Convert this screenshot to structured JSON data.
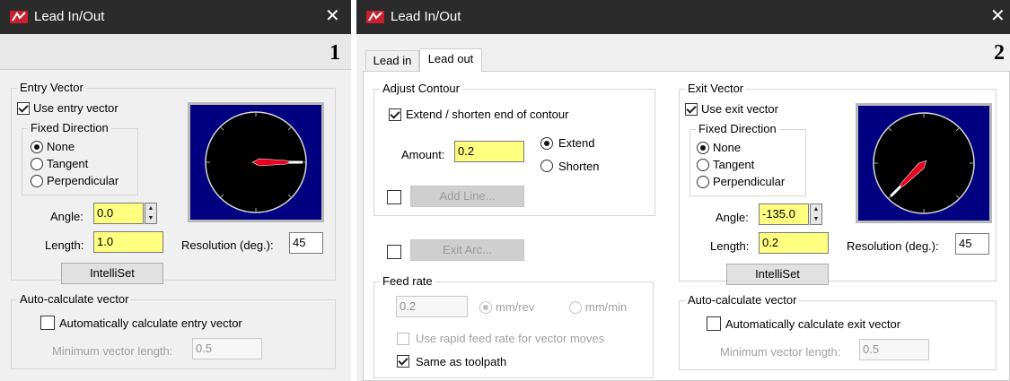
{
  "panel1": {
    "title": "Lead In/Out",
    "close_glyph": "✕",
    "number": "1",
    "entry_vector": {
      "legend": "Entry Vector",
      "use_label": "Use entry vector",
      "use_checked": true,
      "fixed_direction": {
        "legend": "Fixed Direction",
        "options": [
          "None",
          "Tangent",
          "Perpendicular"
        ],
        "selected": "None"
      },
      "angle_label": "Angle:",
      "angle_value": "0.0",
      "length_label": "Length:",
      "length_value": "1.0",
      "resolution_label": "Resolution (deg.):",
      "resolution_value": "45",
      "intelliset_label": "IntelliSet",
      "dial_direction_deg": 0
    },
    "auto_calc": {
      "legend": "Auto-calculate vector",
      "checkbox_label": "Automatically calculate entry vector",
      "checked": false,
      "min_length_label": "Minimum vector length:",
      "min_length_value": "0.5"
    }
  },
  "panel2": {
    "title": "Lead In/Out",
    "close_glyph": "✕",
    "number": "2",
    "tabs": [
      "Lead in",
      "Lead out"
    ],
    "active_tab": "Lead out",
    "adjust_contour": {
      "legend": "Adjust Contour",
      "extend_label": "Extend / shorten end of contour",
      "extend_checked": true,
      "amount_label": "Amount:",
      "amount_value": "0.2",
      "options": [
        "Extend",
        "Shorten"
      ],
      "selected": "Extend",
      "add_line_label": "Add Line..."
    },
    "exit_arc_label": "Exit Arc...",
    "feed_rate": {
      "legend": "Feed rate",
      "value": "0.2",
      "units": [
        "mm/rev",
        "mm/min"
      ],
      "selected_unit": "mm/rev",
      "rapid_label": "Use rapid feed rate for vector moves",
      "rapid_checked": false,
      "same_label": "Same as toolpath",
      "same_checked": true
    },
    "exit_vector": {
      "legend": "Exit Vector",
      "use_label": "Use exit vector",
      "use_checked": true,
      "fixed_direction": {
        "legend": "Fixed Direction",
        "options": [
          "None",
          "Tangent",
          "Perpendicular"
        ],
        "selected": "None"
      },
      "angle_label": "Angle:",
      "angle_value": "-135.0",
      "length_label": "Length:",
      "length_value": "0.2",
      "resolution_label": "Resolution (deg.):",
      "resolution_value": "45",
      "intelliset_label": "IntelliSet",
      "dial_direction_deg": 225
    },
    "auto_calc": {
      "legend": "Auto-calculate vector",
      "checkbox_label": "Automatically calculate exit vector",
      "checked": false,
      "min_length_label": "Minimum vector length:",
      "min_length_value": "0.5"
    }
  },
  "colors": {
    "titlebar": "#2b2b2b",
    "dial_background": "#000080",
    "vector_red": "#e8001c",
    "field_highlight": "#ffff80"
  }
}
